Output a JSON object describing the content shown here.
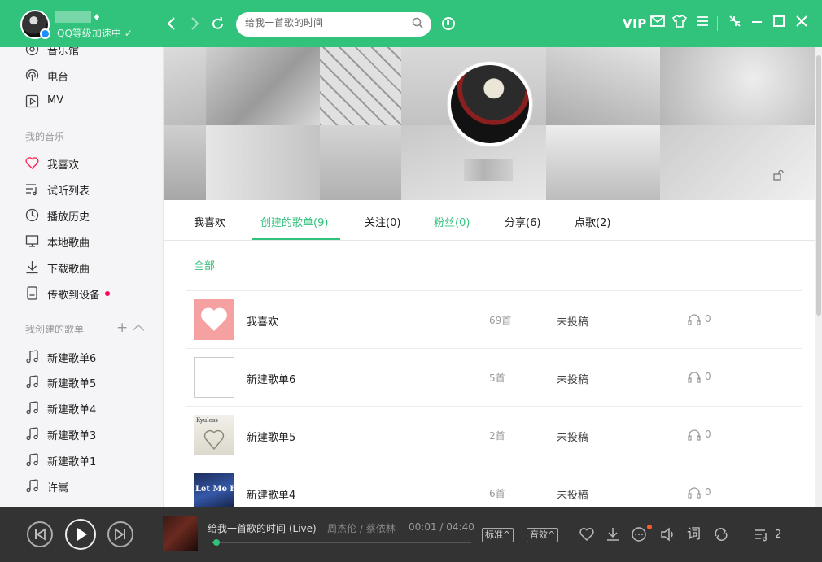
{
  "topbar": {
    "level_text": "QQ等级加速中",
    "search_placeholder": "给我一首歌的时间",
    "vip_label": "VIP"
  },
  "sidebar": {
    "top_items": [
      {
        "label": "音乐馆",
        "icon": "music-hall-icon"
      },
      {
        "label": "电台",
        "icon": "radio-icon"
      },
      {
        "label": "MV",
        "icon": "mv-icon"
      }
    ],
    "my_music_header": "我的音乐",
    "my_music_items": [
      {
        "label": "我喜欢",
        "icon": "heart-icon"
      },
      {
        "label": "试听列表",
        "icon": "trial-list-icon"
      },
      {
        "label": "播放历史",
        "icon": "history-icon"
      },
      {
        "label": "本地歌曲",
        "icon": "local-songs-icon"
      },
      {
        "label": "下载歌曲",
        "icon": "download-icon"
      },
      {
        "label": "传歌到设备",
        "icon": "device-transfer-icon"
      }
    ],
    "created_header": "我创建的歌单",
    "created_items": [
      {
        "label": "新建歌单6"
      },
      {
        "label": "新建歌单5"
      },
      {
        "label": "新建歌单4"
      },
      {
        "label": "新建歌单3"
      },
      {
        "label": "新建歌单1"
      },
      {
        "label": "许嵩"
      }
    ]
  },
  "tabs": [
    {
      "label": "我喜欢"
    },
    {
      "label": "创建的歌单(9)"
    },
    {
      "label": "关注(0)"
    },
    {
      "label": "粉丝(0)"
    },
    {
      "label": "分享(6)"
    },
    {
      "label": "点歌(2)"
    }
  ],
  "filter_all": "全部",
  "playlists": [
    {
      "name": "我喜欢",
      "count": "69首",
      "status": "未投稿",
      "listens": "0"
    },
    {
      "name": "新建歌单6",
      "count": "5首",
      "status": "未投稿",
      "listens": "0"
    },
    {
      "name": "新建歌单5",
      "count": "2首",
      "status": "未投稿",
      "listens": "0"
    },
    {
      "name": "新建歌单4",
      "count": "6首",
      "status": "未投稿",
      "listens": "0"
    }
  ],
  "cover_texts": {
    "kyuless": "Kyuless",
    "let_me_hear": "Let Me Hear"
  },
  "player": {
    "title": "给我一首歌的时间 (Live)",
    "artist": "- 周杰伦 / 蔡依林",
    "time": "00:01 / 04:40",
    "progress": 0.01,
    "quality_label": "标准",
    "effect_label": "音效",
    "lyrics_label": "词",
    "queue_count": "2"
  },
  "colors": {
    "accent": "#31c27c",
    "player_bg": "#333333",
    "sidebar_bg": "#f5f5f7",
    "notify_red": "#ff0055",
    "notify_orange": "#ff5a2c"
  }
}
